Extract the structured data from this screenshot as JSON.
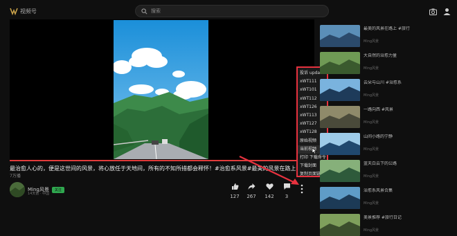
{
  "header": {
    "logo_text": "视频号",
    "search_placeholder": "搜索"
  },
  "video": {
    "title": "最治愈人心的，便是这世间的风景，将心放任于天地间，所有的不知所措都会释怀！#治愈系风景#最美的风景在路上#美景推",
    "views": "7万播",
    "progress": 1.0
  },
  "channel": {
    "name": "Ming风景",
    "badge": "关注",
    "sub": "14天前 · 中国"
  },
  "actions": [
    {
      "icon": "thumbs-up-icon",
      "count": "127"
    },
    {
      "icon": "share-icon",
      "count": "267"
    },
    {
      "icon": "heart-icon",
      "count": "142"
    },
    {
      "icon": "comment-icon",
      "count": "3"
    }
  ],
  "context_menu": {
    "items": [
      "投诉 update",
      "xWT111",
      "xWT101",
      "xWT112",
      "xWT126",
      "xWT113",
      "xWT127",
      "xWT128",
      "原始视频",
      "当前视频",
      "打印 下载命令",
      "下载封面",
      "复制页面链接"
    ],
    "highlighted_index": 9
  },
  "sidebar": {
    "items": [
      {
        "title": "最美的风景在路上 #旅行",
        "meta": "Ming风景"
      },
      {
        "title": "大自然的治愈力量",
        "meta": "Ming风景"
      },
      {
        "title": "云朵与山川 #治愈系",
        "meta": "Ming风景"
      },
      {
        "title": "一路向西 #风景",
        "meta": "Ming风景"
      },
      {
        "title": "山间小路的宁静",
        "meta": "Ming风景"
      },
      {
        "title": "蓝天白云下的公路",
        "meta": "Ming风景"
      },
      {
        "title": "治愈系风景合集",
        "meta": "Ming风景"
      },
      {
        "title": "美景推荐 #旅行日记",
        "meta": "Ming风景"
      }
    ]
  },
  "colors": {
    "accent": "#e8323f",
    "badge": "#2fa84f",
    "background": "#0f0f0f"
  }
}
